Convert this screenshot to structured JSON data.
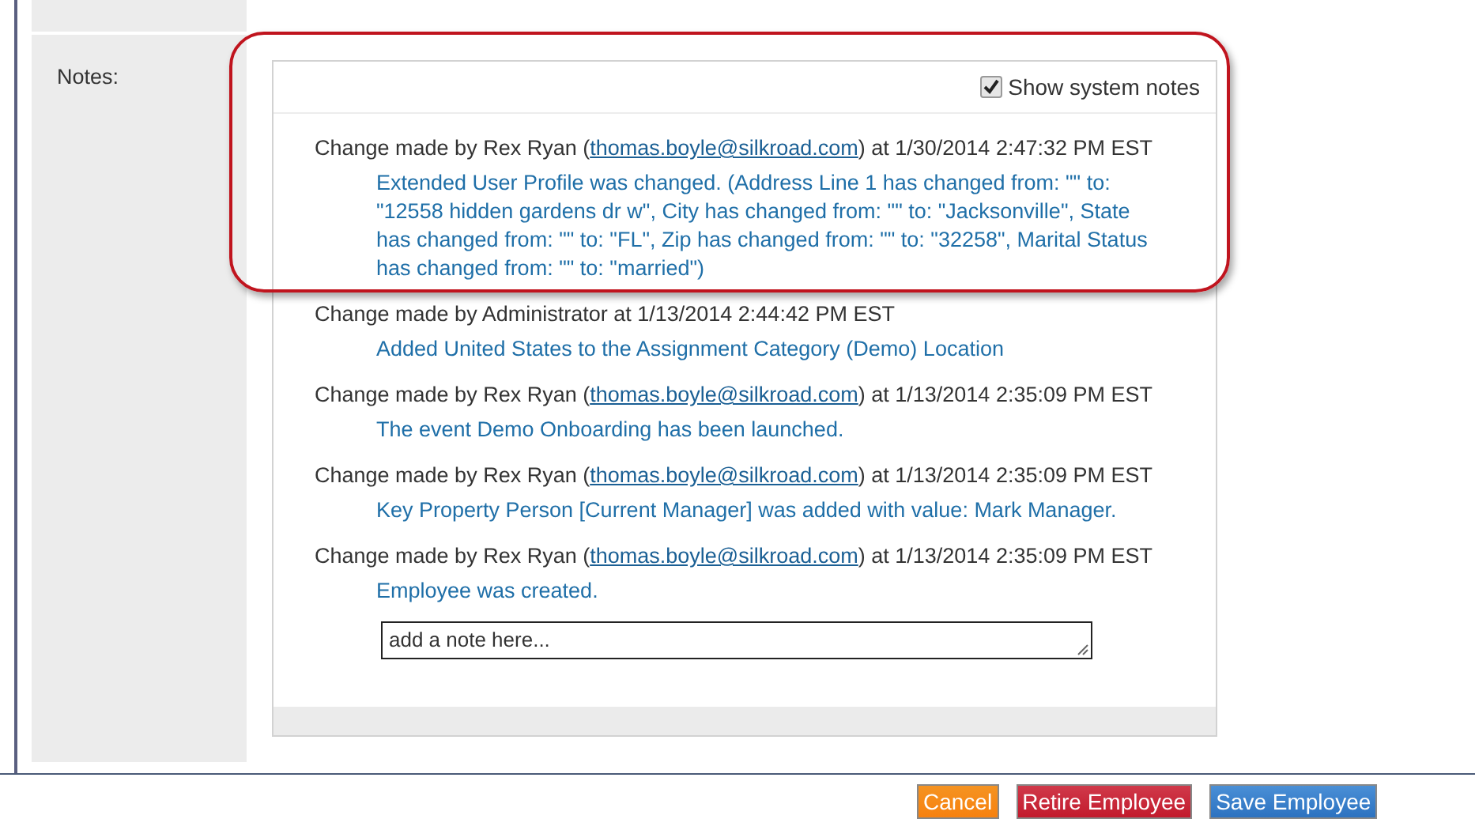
{
  "field_label": "Notes:",
  "show_system_notes": {
    "label": "Show system notes",
    "checked": true
  },
  "notes": [
    {
      "header_before": "Change made by Rex Ryan (",
      "email": "thomas.boyle@silkroad.com",
      "header_after": ") at 1/30/2014 2:47:32 PM EST",
      "detail": "Extended User Profile was changed. (Address Line 1 has changed from: \"\" to: \"12558 hidden gardens dr w\", City has changed from: \"\" to: \"Jacksonville\", State has changed from: \"\" to: \"FL\", Zip has changed from: \"\" to: \"32258\", Marital Status has changed from: \"\" to: \"married\")"
    },
    {
      "header_before": "Change made by Administrator at 1/13/2014 2:44:42 PM EST",
      "detail": "Added United States to the Assignment Category (Demo) Location"
    },
    {
      "header_before": "Change made by Rex Ryan (",
      "email": "thomas.boyle@silkroad.com",
      "header_after": ") at 1/13/2014 2:35:09 PM EST",
      "detail": "The event Demo Onboarding has been launched."
    },
    {
      "header_before": "Change made by Rex Ryan (",
      "email": "thomas.boyle@silkroad.com",
      "header_after": ") at 1/13/2014 2:35:09 PM EST",
      "detail": "Key Property Person [Current Manager] was added with value: Mark Manager."
    },
    {
      "header_before": "Change made by Rex Ryan (",
      "email": "thomas.boyle@silkroad.com",
      "header_after": ") at 1/13/2014 2:35:09 PM EST",
      "detail": "Employee was created."
    }
  ],
  "note_input": {
    "placeholder": "add a note here..."
  },
  "buttons": [
    {
      "label": "Cancel",
      "kind": "cancel"
    },
    {
      "label": "Retire Employee",
      "kind": "danger"
    },
    {
      "label": "Save Employee",
      "kind": "primary"
    }
  ]
}
